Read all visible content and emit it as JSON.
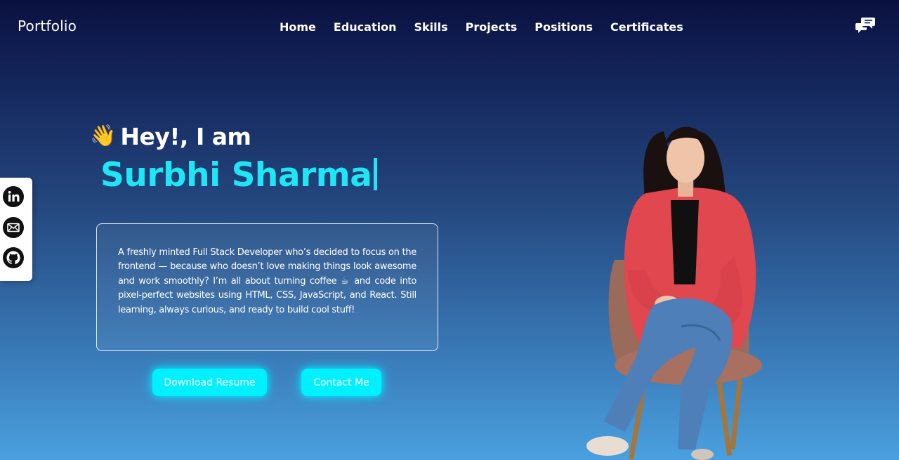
{
  "nav": {
    "brand": "Portfolio",
    "links": [
      "Home",
      "Education",
      "Skills",
      "Projects",
      "Positions",
      "Certificates"
    ],
    "chat_icon": "chat-bubbles-icon"
  },
  "social": {
    "icons": [
      "linkedin-icon",
      "mail-icon",
      "github-icon"
    ]
  },
  "hero": {
    "wave_emoji": "👋",
    "greeting": "Hey!, I am",
    "name": "Surbhi Sharma",
    "about": "A freshly minted Full Stack Developer who’s decided to focus on the frontend — because who doesn’t love making things look awesome and work smoothly? I’m all about turning coffee ☕ and code into pixel-perfect websites using HTML, CSS, JavaScript, and React. Still learning, always curious, and ready to build cool stuff!",
    "buttons": {
      "resume": "Download Resume",
      "contact": "Contact Me"
    }
  },
  "colors": {
    "accent": "#1ee6f5",
    "button": "#00f0ff",
    "bg_top": "#0a1140",
    "bg_bottom": "#4aa0df"
  }
}
